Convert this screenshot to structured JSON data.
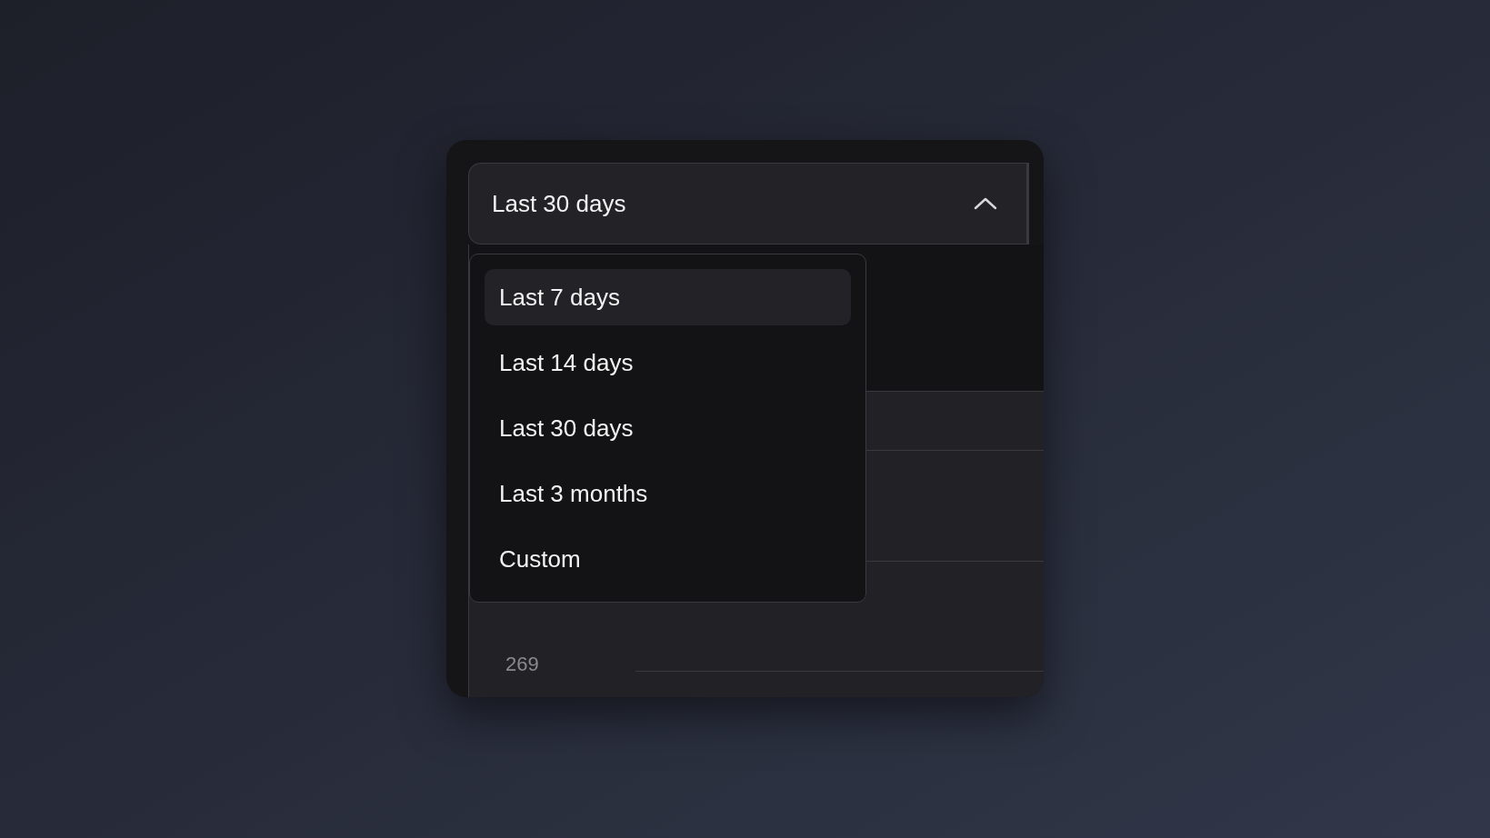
{
  "select": {
    "value": "Last 30 days",
    "expanded": true
  },
  "options": [
    {
      "label": "Last 7 days",
      "highlighted": true
    },
    {
      "label": "Last 14 days",
      "highlighted": false
    },
    {
      "label": "Last 30 days",
      "highlighted": false
    },
    {
      "label": "Last 3 months",
      "highlighted": false
    },
    {
      "label": "Custom",
      "highlighted": false
    }
  ],
  "axis_label": "269"
}
